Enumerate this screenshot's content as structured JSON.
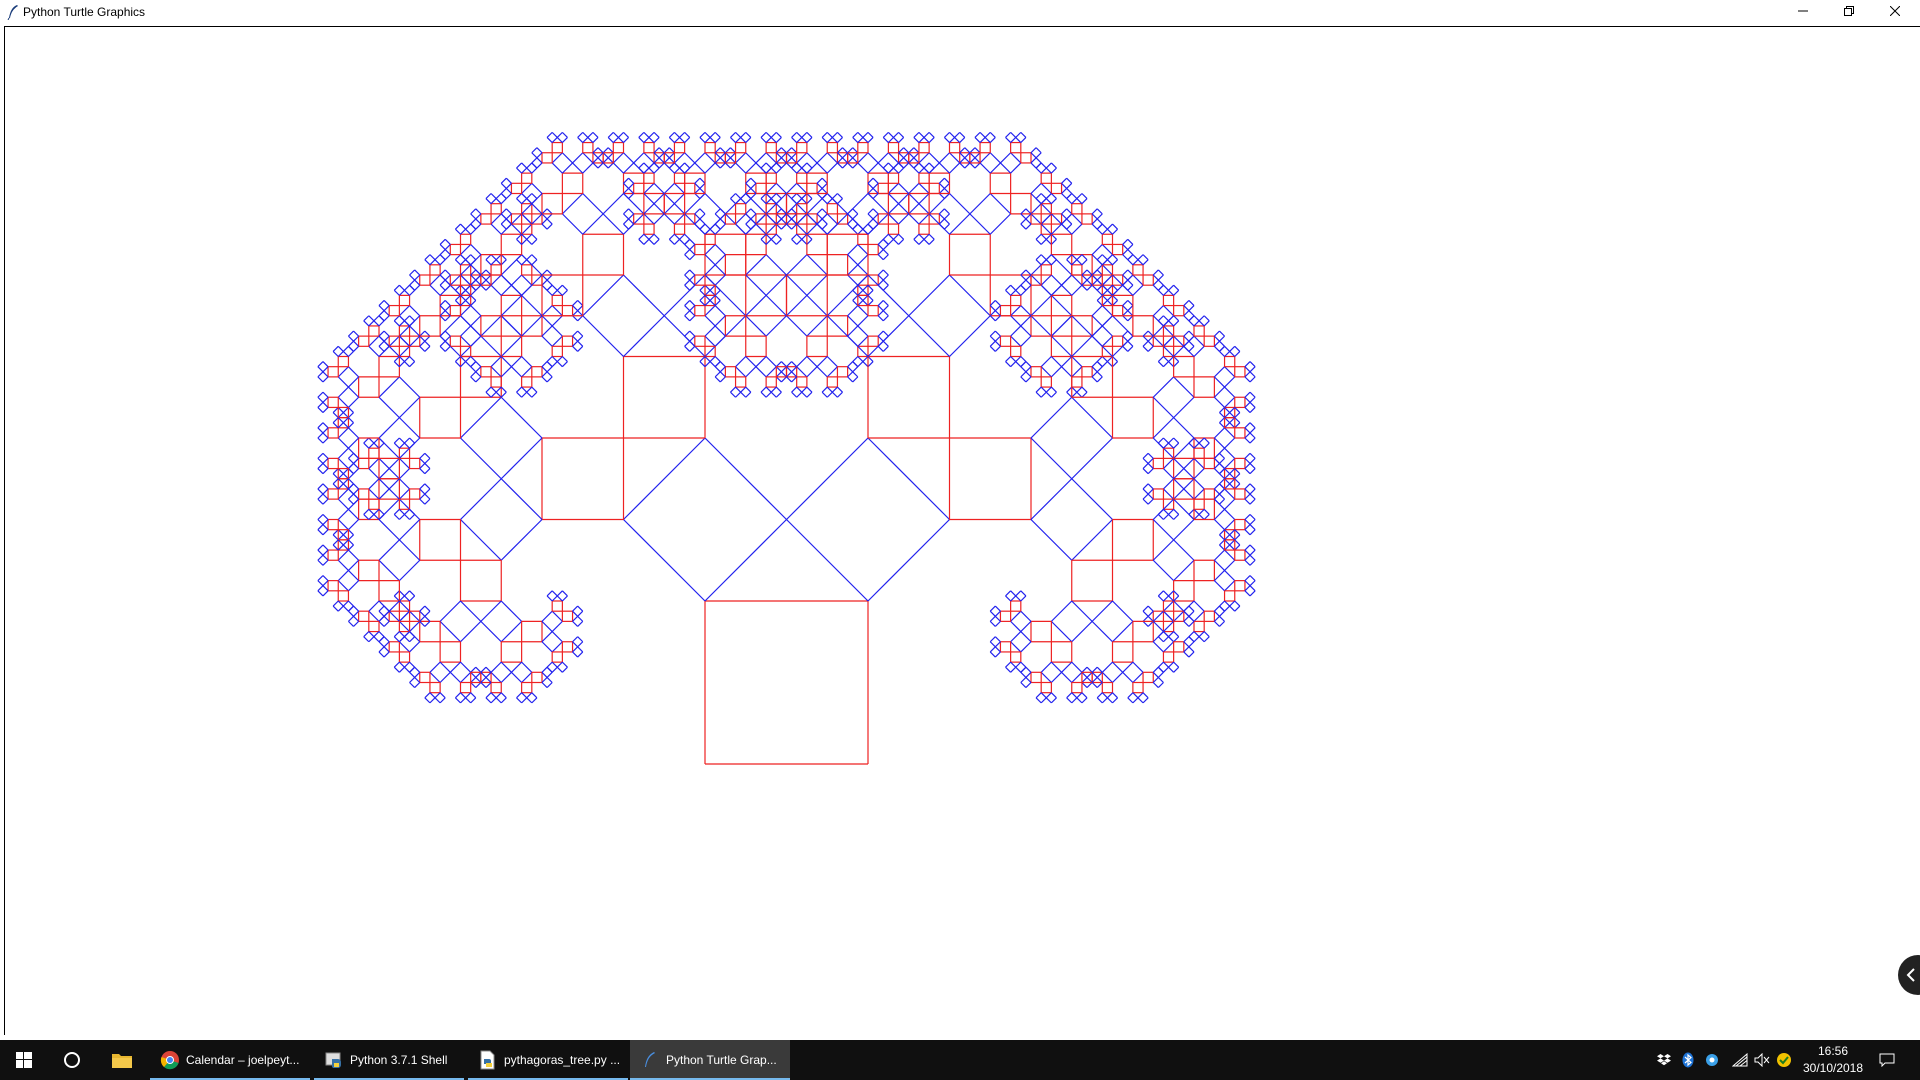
{
  "window": {
    "title": "Python Turtle Graphics"
  },
  "drawing": {
    "type": "pythagoras-tree",
    "colors": {
      "primary": "#ee2222",
      "secondary": "#2222ee"
    },
    "depth": 9
  },
  "taskbar": {
    "apps": [
      {
        "label": "Calendar – joelpeyt...",
        "icon": "chrome-icon",
        "active": false
      },
      {
        "label": "Python 3.7.1 Shell",
        "icon": "python-shell-icon",
        "active": false
      },
      {
        "label": "pythagoras_tree.py ...",
        "icon": "python-file-icon",
        "active": false
      },
      {
        "label": "Python Turtle Grap...",
        "icon": "turtle-feather-icon",
        "active": true
      }
    ],
    "tray": {
      "time": "16:56",
      "date": "30/10/2018"
    }
  }
}
